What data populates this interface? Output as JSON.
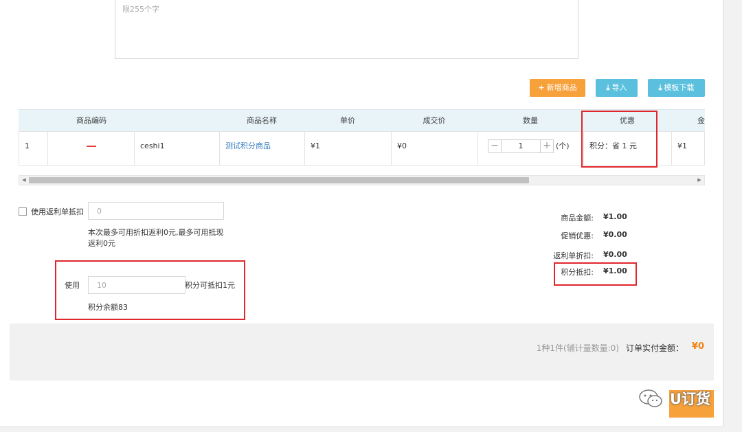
{
  "remark": {
    "placeholder": "限255个字"
  },
  "toolbar": {
    "add_product": "新增商品",
    "import": "导入",
    "template_download": "模板下载"
  },
  "table": {
    "headers": [
      "商品编码",
      "商品名称",
      "单价",
      "成交价",
      "数量",
      "优惠",
      "金"
    ],
    "row": {
      "index": "1",
      "code": "ceshi1",
      "name": "测试积分商品",
      "unit_price": "¥1",
      "deal_price": "¥0",
      "quantity": "1",
      "unit": "(个)",
      "discount": "积分：省 1 元",
      "amount": "¥1"
    }
  },
  "rebate": {
    "label": "使用返利单抵扣",
    "value": "0",
    "note": "本次最多可用折扣返利0元,最多可用抵现返利0元"
  },
  "points": {
    "use_label": "使用",
    "placeholder": "10",
    "suffix": "积分可抵扣1元",
    "balance": "积分余额83"
  },
  "summary": [
    {
      "label": "商品金额:",
      "value": "¥1.00"
    },
    {
      "label": "促销优惠:",
      "value": "¥0.00"
    },
    {
      "label": "返利单折扣:",
      "value": "¥0.00"
    },
    {
      "label": "积分抵扣:",
      "value": "¥1.00"
    }
  ],
  "footer": {
    "count": "1种1件(辅计量数量:0)",
    "total_label": "订单实付金额：",
    "total_value": "¥0"
  },
  "watermark": "U订货",
  "colors": {
    "accent_orange": "#f7a13b",
    "accent_blue": "#5bc0de",
    "highlight_red": "#e0262c",
    "amount_orange": "#f08519"
  }
}
